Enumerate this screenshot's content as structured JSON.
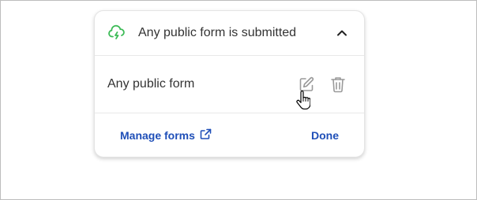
{
  "trigger": {
    "title": "Any public form is submitted",
    "icon": "cloud-lightning-icon",
    "collapse_icon": "chevron-up-icon",
    "accent": "#3dbb57"
  },
  "item": {
    "label": "Any public form",
    "edit_icon": "edit-icon",
    "delete_icon": "trash-icon"
  },
  "footer": {
    "manage_label": "Manage forms",
    "manage_icon": "external-link-icon",
    "done_label": "Done",
    "link_color": "#1f4fb8"
  }
}
